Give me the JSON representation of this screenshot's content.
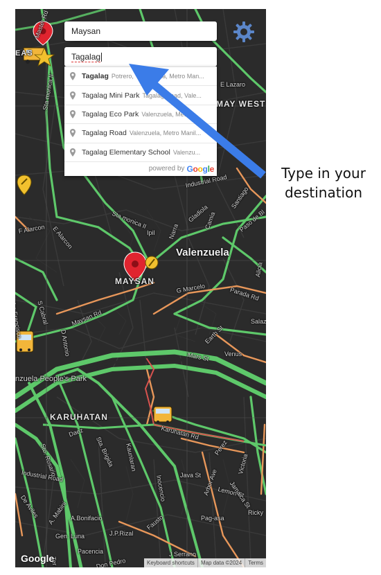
{
  "search": {
    "origin_value": "Maysan",
    "destination_value": "Tagalag"
  },
  "suggestions": [
    {
      "main": "Tagalag",
      "secondary": "Potrero, Valenzuela, Metro Man..."
    },
    {
      "main": "Tagalag Mini Park",
      "secondary": "Tagalag Road, Vale..."
    },
    {
      "main": "Tagalag Eco Park",
      "secondary": "Valenzuela, Metro ..."
    },
    {
      "main": "Tagalag Road",
      "secondary": "Valenzuela, Metro Manil..."
    },
    {
      "main": "Tagalag Elementary School",
      "secondary": "Valenzu..."
    }
  ],
  "powered_by": {
    "text": "powered by",
    "logo": "Google"
  },
  "map": {
    "labels": {
      "city": "Valenzuela",
      "maysan": "MAYSAN",
      "karuhatan": "KARUHATAN",
      "may_west": "MAY WEST",
      "peoples_park": "nzuela People's Park",
      "lazaro": "E Lazaro",
      "santiago": "Santiago",
      "industrial_road_top": "Industrial Road",
      "industrial_road_bottom": "Industrial Road",
      "sta_monica": "Sta monica II",
      "ipil": "Ipil",
      "narra": "Narra",
      "gladiola": "Gladiola",
      "camia": "Camia",
      "paso_de_blas": "Paso de Bl",
      "alicia": "Alicia",
      "g_marcelo": "G Marcelo",
      "parada_rd": "Parada Rd",
      "salaz": "Salaz",
      "maysan_rd": "Maysan Rd",
      "s_cabral": "S Cabral",
      "isidro_francisco": "Isidro Francisco",
      "d_antonio": "D Antonio",
      "earth_st": "Earth St",
      "mars_st": "Mars St",
      "venus": "Venus",
      "karuhatan_rd": "Karuhatan Rd",
      "daez": "Daez",
      "sto_rosario": "Sto. Rosario",
      "sta_brigida": "Sta. Brigida",
      "kaunlaran": "Kaunlaran",
      "perez": "Perez",
      "victoria": "Victoria",
      "arbor_ave": "Arbor Ave",
      "java_st": "Java St",
      "lemon_st": "Lemon St",
      "jamaica_st": "Jamaica St",
      "inocencio": "Inocencio",
      "de_aviles": "De Aviles",
      "a_mabini": "A. Mabini",
      "a_bonifacio": "A.Bonifacio",
      "gen_luna": "Gen. Luna",
      "j_p_rizal": "J.P.Rizal",
      "fausto": "Fausto",
      "pag_asa": "Pag-asa",
      "ricky": "Ricky",
      "pacencia": "Pacencia",
      "don_pedro": "Don Pedro",
      "j_serrano": "J Serrano",
      "f_alarcon": "F Alarcon",
      "e_alarcon": "E Alarcon",
      "master_rd": "Master Rd",
      "sta_monica_top": "Sta monica II",
      "eas": "EAS",
      "ter": "Ter"
    }
  },
  "footer": {
    "google_logo": "Google",
    "keyboard_shortcuts": "Keyboard shortcuts",
    "map_data": "Map data ©2024",
    "terms": "Terms"
  },
  "annotation": {
    "line1": "Type in your",
    "line2": "destination",
    "arrow_color": "#3b7ce8"
  },
  "colors": {
    "map_background": "#2b2b2b",
    "road_green": "#5ec86a",
    "road_orange": "#e8975a",
    "road_red": "#d9534f",
    "marker_red": "#e0242f",
    "marker_yellow": "#f2c12e"
  }
}
